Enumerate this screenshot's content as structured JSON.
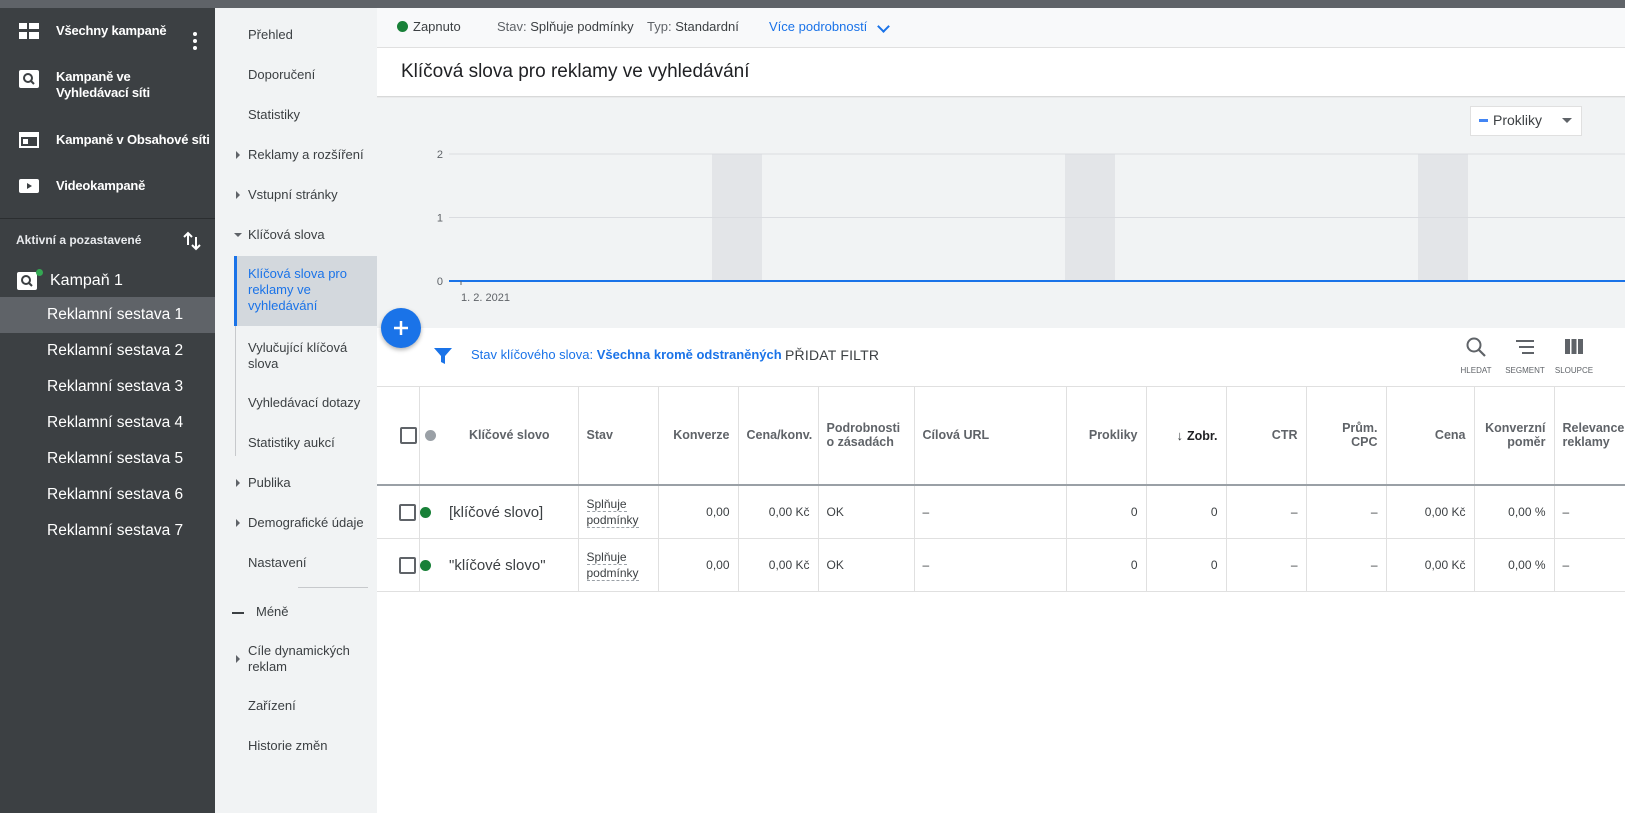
{
  "sidebar": {
    "nav": [
      {
        "label": "Všechny kampaně",
        "icon": "grid-icon"
      },
      {
        "label": "Kampaně ve Vyhledávací síti",
        "icon": "search-icon"
      },
      {
        "label": "Kampaně v Obsahové síti",
        "icon": "display-icon"
      },
      {
        "label": "Videokampaně",
        "icon": "video-icon"
      }
    ],
    "section_label": "Aktivní a pozastavené",
    "campaign": "Kampaň 1",
    "ad_groups": [
      "Reklamní sestava 1",
      "Reklamní sestava 2",
      "Reklamní sestava 3",
      "Reklamní sestava 4",
      "Reklamní sestava 5",
      "Reklamní sestava 6",
      "Reklamní sestava 7"
    ]
  },
  "subnav": {
    "overview": "Přehled",
    "recommendations": "Doporučení",
    "statistics": "Statistiky",
    "ads": "Reklamy a rozšíření",
    "landing": "Vstupní stránky",
    "keywords": "Klíčová slova",
    "keywords_search": "Klíčová slova pro reklamy ve vyhledávání",
    "negative": "Vylučující klíčová slova",
    "search_terms": "Vyhledávací dotazy",
    "auction": "Statistiky aukcí",
    "audiences": "Publika",
    "demographics": "Demografické údaje",
    "settings": "Nastavení",
    "less": "Méně",
    "dynamic": "Cíle dynamických reklam",
    "devices": "Zařízení",
    "history": "Historie změn"
  },
  "status": {
    "enabled": "Zapnuto",
    "state_key": "Stav:",
    "state_value": "Splňuje podmínky",
    "type_key": "Typ:",
    "type_value": "Standardní",
    "more": "Více podrobností"
  },
  "page_title": "Klíčová slova pro reklamy ve vyhledávání",
  "chart": {
    "metric": "Prokliky",
    "colors": {
      "line": "#1a73e8",
      "weekend": "#e3e5e8",
      "grid": "#dadce0"
    }
  },
  "chart_data": {
    "type": "line",
    "series": [
      {
        "name": "Prokliky",
        "values": [
          0,
          0
        ]
      }
    ],
    "x_start_label": "1. 2. 2021",
    "y_ticks": [
      "0",
      "1",
      "2"
    ],
    "ylim": [
      0,
      2
    ]
  },
  "filter": {
    "label": "Stav klíčového slova:",
    "value": "Všechna kromě odstraněných",
    "add": "PŘIDAT FILTR"
  },
  "tools": {
    "search": "HLEDAT",
    "segment": "SEGMENT",
    "columns": "SLOUPCE"
  },
  "table": {
    "headers": {
      "keyword": "Klíčové slovo",
      "status": "Stav",
      "conversions": "Konverze",
      "cost_conv": "Cena/konv.",
      "policy": "Podrobnosti o zásadách",
      "final_url": "Cílová URL",
      "clicks": "Prokliky",
      "impr": "Zobr.",
      "ctr": "CTR",
      "avg_cpc": "Prům. CPC",
      "cost": "Cena",
      "conv_rate": "Konverzní poměr",
      "relevance": "Relevance reklamy"
    },
    "rows": [
      {
        "keyword": "[klíčové slovo]",
        "status": "Splňuje podmínky",
        "conversions": "0,00",
        "cost_conv": "0,00 Kč",
        "policy": "OK",
        "final_url": "–",
        "clicks": "0",
        "impr": "0",
        "ctr": "–",
        "avg_cpc": "–",
        "cost": "0,00 Kč",
        "conv_rate": "0,00 %",
        "relevance": "–"
      },
      {
        "keyword": "\"klíčové slovo\"",
        "status": "Splňuje podmínky",
        "conversions": "0,00",
        "cost_conv": "0,00 Kč",
        "policy": "OK",
        "final_url": "–",
        "clicks": "0",
        "impr": "0",
        "ctr": "–",
        "avg_cpc": "–",
        "cost": "0,00 Kč",
        "conv_rate": "0,00 %",
        "relevance": "–"
      }
    ]
  }
}
